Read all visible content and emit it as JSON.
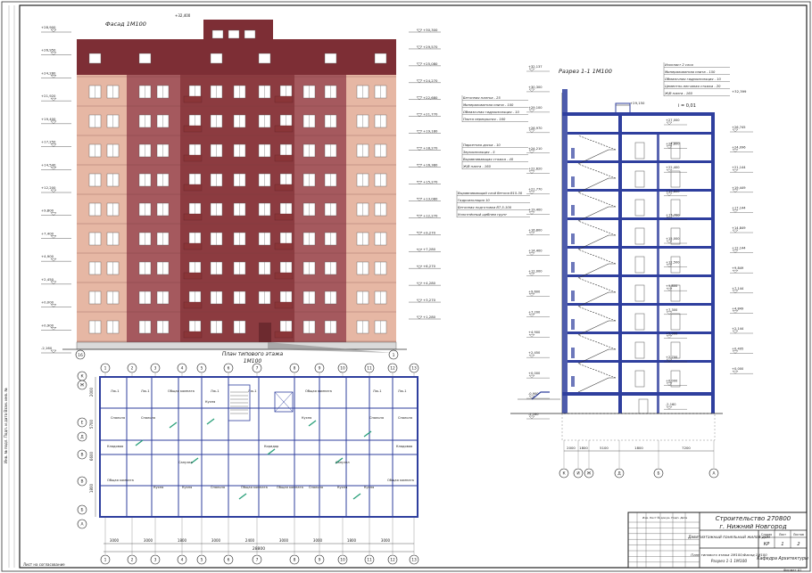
{
  "facade": {
    "title": "Фасад  1М100",
    "axis_left": "16",
    "axis_right": "1",
    "marks_left": [
      "+28,900",
      "+26,950",
      "+24,280",
      "+21,920",
      "+19,400",
      "+17,250",
      "+14,540",
      "+12,200",
      "+9,800",
      "+7,400",
      "+4,900",
      "+2,450",
      "+0,000",
      "+0,900",
      "-2,160"
    ],
    "marks_right": [
      "+30,300",
      "+29,570",
      "+25,080",
      "+24,270",
      "+22,680",
      "+21,770",
      "+19,180",
      "+18,270",
      "+16,380",
      "+15,270",
      "+13,080",
      "+12,270",
      "+9,270",
      "+7,280",
      "+6,270",
      "+4,280",
      "+3,270",
      "+1,280"
    ],
    "top_mark": "+32,400",
    "colors": {
      "wall": "#a5595e",
      "wall_light": "#e6b7a4",
      "roof": "#7d2e35",
      "band": "#8c3b40",
      "loggia": "#8a3538"
    }
  },
  "plan": {
    "title": "План типового этажа",
    "subtitle": "1М100",
    "rooms": {
      "living_big": "Общая комната",
      "living": "Общая комната",
      "bedroom": "Спальня",
      "kitchen": "Кухня",
      "bathroom": "Санузел",
      "hall": "Коридор",
      "corridor": "Коридор",
      "storage": "Кладовая",
      "loggia": "Лж-1"
    },
    "axes_bottom": [
      "1",
      "2",
      "3",
      "4",
      "5",
      "6",
      "7",
      "8",
      "9",
      "10",
      "11",
      "12",
      "13"
    ],
    "axes_top": [
      "1",
      "2",
      "3",
      "4",
      "5",
      "6",
      "7",
      "8",
      "9",
      "10",
      "11",
      "12",
      "13"
    ],
    "axes_left": [
      "К",
      "Ж",
      "Е",
      "Д",
      "В",
      "В",
      "Б",
      "А"
    ],
    "dims_bottom": [
      "3000",
      "3000",
      "1800",
      "3000",
      "2400",
      "3000",
      "3000",
      "1800",
      "3000"
    ],
    "dims_total": "28800",
    "dims_left": [
      "2000",
      "5700",
      "6600",
      "1800"
    ]
  },
  "section": {
    "title": "Разрез 1-1  1М100",
    "slope": "i = 0,01",
    "roof_spec": [
      "Изопласт 2 слоя",
      "Минераловатная плита - 150",
      "Обмазочная гидроизоляция - 10",
      "Цементно-песчаная стяжка - 20",
      "Ж/б плита - 160"
    ],
    "spec_a": [
      "Бетонная плитка - 25",
      "Минераловатная плита - 100",
      "Обмазочная гидроизоляция - 10",
      "Плита перекрытия - 160"
    ],
    "spec_b": [
      "Паркетная доска - 10",
      "Звукоизоляция - 5",
      "Выравнивающая стяжка - 40",
      "Ж/б плита - 160"
    ],
    "spec_c": [
      "Выравнивающий слой бетона В15-30",
      "Гидроизоляция 10",
      "Бетонная подготовка В7,5-100",
      "Уплотнённый щебнем грунт"
    ],
    "axes": [
      "К",
      "И",
      "Ж",
      "Д",
      "Б",
      "А"
    ],
    "dims": [
      "2000",
      "1800",
      "5100",
      "1800",
      "7200"
    ],
    "levels_left": [
      "+32,137",
      "+30,300",
      "+29,100",
      "+26,970",
      "+24,210",
      "+22,620",
      "+21,770",
      "+19,400",
      "+16,800",
      "+14,400",
      "+12,000",
      "+9,600",
      "+7,200",
      "+4,900",
      "+2,450",
      "+0,000",
      "-0,900",
      "-2,160"
    ],
    "levels_in": [
      "+27,000",
      "+24,800",
      "+22,400",
      "+19,800",
      "+17,700",
      "+15,000",
      "+12,500",
      "+9,800",
      "+7,300",
      "+5,000",
      "+2,700",
      "+0,000",
      "-2,160"
    ],
    "levels_right": [
      "+26,745",
      "+24,096",
      "+21,144",
      "+19,449",
      "+17,144",
      "+14,849",
      "+12,144",
      "+9,849",
      "+7,144",
      "+4,849",
      "+2,144",
      "+0,495",
      "+0,000"
    ],
    "right_top": "+32,399",
    "top_mark": "+29,150"
  },
  "stamp": {
    "title_line1": "Строительство 270800",
    "title_line2": "г. Нижний Новгород",
    "desc": "Девятиэтажный панельный жилой дом",
    "sheet_desc1": "План типового этажа 1М100;Фасад 1М100",
    "sheet_desc2": "Разрез 1-1 1М100",
    "stage_h": "Стадия",
    "sheet_h": "Лист",
    "sheets_h": "Листов",
    "stage": "КР",
    "sheet": "1",
    "sheets": "2",
    "org": "Кафедра  Архитектуры",
    "format": "Формат  А1",
    "side_note": "Изм. Лист № докум. Подп. Дата",
    "bottom_note": "Лист на согласование",
    "left_note": "Инв. № подл.  Подп. и дата  Взам. инв. №"
  }
}
